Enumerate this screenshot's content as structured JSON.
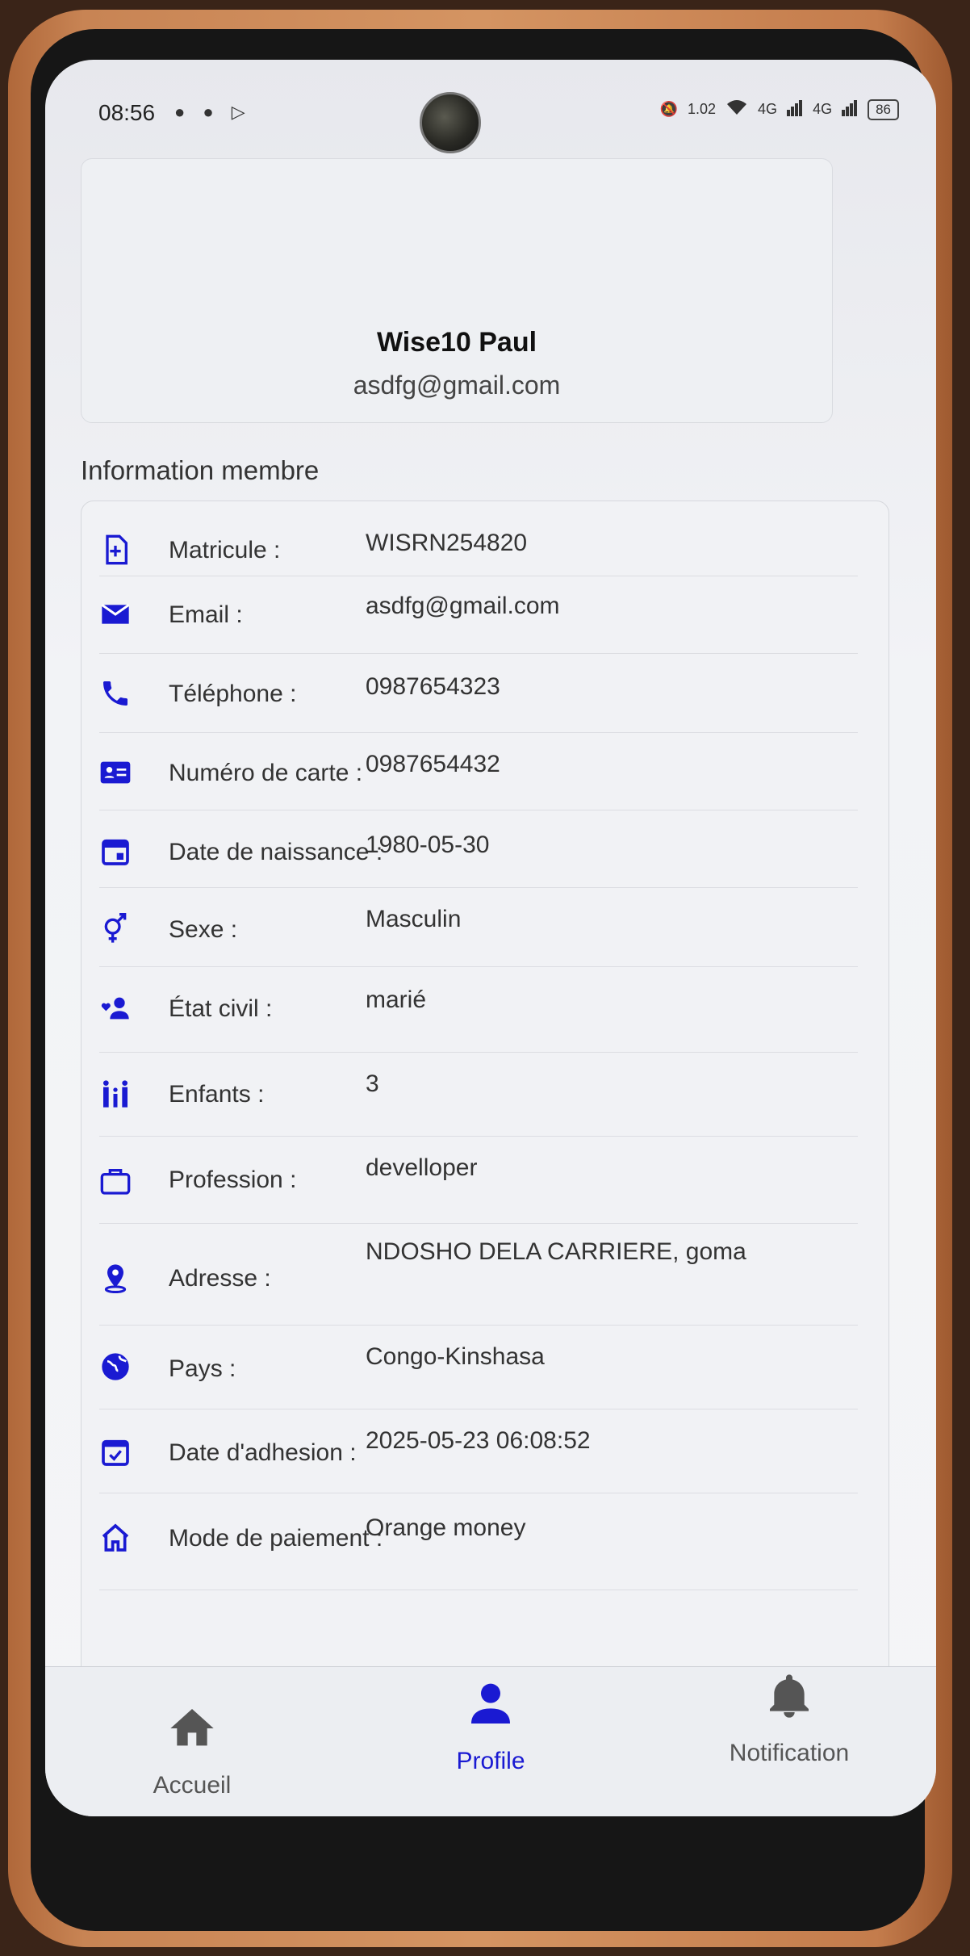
{
  "status_bar": {
    "time": "08:56",
    "notifications": "● ● ▷",
    "network_speed": "1.02",
    "signal1": "4G",
    "signal2": "4G",
    "battery": "86"
  },
  "profile": {
    "name": "Wise10 Paul",
    "email": "asdfg@gmail.com"
  },
  "section_title": "Information membre",
  "info": [
    {
      "icon": "id-document-icon",
      "label": "Matricule :",
      "value": "WISRN254820"
    },
    {
      "icon": "email-icon",
      "label": "Email :",
      "value": "asdfg@gmail.com"
    },
    {
      "icon": "phone-icon",
      "label": "Téléphone :",
      "value": "0987654323"
    },
    {
      "icon": "id-card-icon",
      "label": "Numéro de carte :",
      "value": "0987654432"
    },
    {
      "icon": "calendar-icon",
      "label": "Date de naissance :",
      "value": "1980-05-30"
    },
    {
      "icon": "gender-icon",
      "label": "Sexe :",
      "value": "Masculin"
    },
    {
      "icon": "marital-status-icon",
      "label": "État civil :",
      "value": "marié"
    },
    {
      "icon": "family-icon",
      "label": "Enfants :",
      "value": "3"
    },
    {
      "icon": "briefcase-icon",
      "label": "Profession :",
      "value": "develloper"
    },
    {
      "icon": "location-pin-icon",
      "label": "Adresse :",
      "value": "NDOSHO DELA CARRIERE, goma"
    },
    {
      "icon": "globe-icon",
      "label": "Pays :",
      "value": "Congo-Kinshasa"
    },
    {
      "icon": "calendar-check-icon",
      "label": "Date d'adhesion :",
      "value": "2025-05-23 06:08:52"
    },
    {
      "icon": "home-icon",
      "label": "Mode de paiement :",
      "value": "Orange money"
    }
  ],
  "nav": [
    {
      "label": "Accueil",
      "icon": "home-icon",
      "active": false
    },
    {
      "label": "Profile",
      "icon": "person-icon",
      "active": true
    },
    {
      "label": "Notification",
      "icon": "bell-icon",
      "active": false
    }
  ],
  "colors": {
    "accent": "#1a1ad2",
    "inactive": "#555555"
  }
}
